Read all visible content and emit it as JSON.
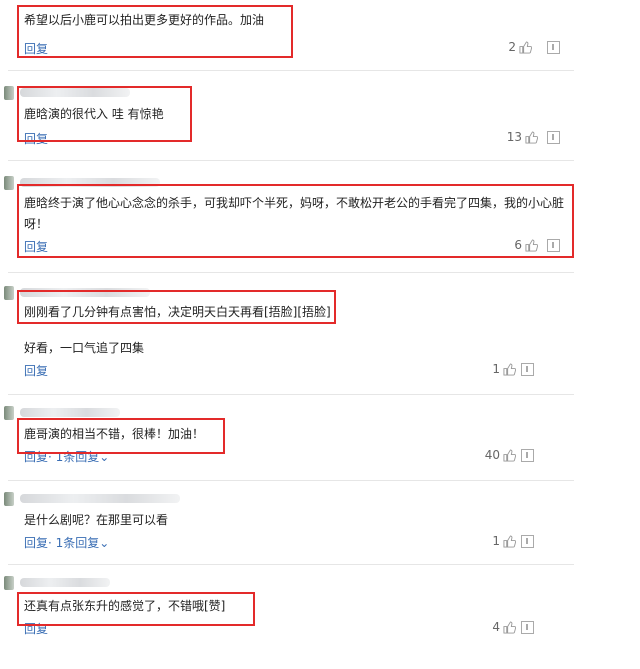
{
  "comments": [
    {
      "text": "希望以后小鹿可以拍出更多更好的作品。加油",
      "reply": "回复",
      "likes": "2"
    },
    {
      "text": "鹿晗演的很代入 哇 有惊艳",
      "reply": "回复",
      "likes": "13"
    },
    {
      "text": "鹿晗终于演了他心心念念的杀手，可我却吓个半死，妈呀，不敢松开老公的手看完了四集，我的小心脏呀！",
      "reply": "回复",
      "likes": "6"
    },
    {
      "text": "刚刚看了几分钟有点害怕，决定明天白天再看[捂脸][捂脸]"
    },
    {
      "text": "好看，一口气追了四集",
      "reply": "回复",
      "likes": "1"
    },
    {
      "text": "鹿哥演的相当不错，很棒！加油！",
      "reply": "回复",
      "more": "· 1条回复⌄",
      "likes": "40"
    },
    {
      "text": "是什么剧呢？在那里可以看",
      "reply": "回复",
      "more": "· 1条回复⌄",
      "likes": "1"
    },
    {
      "text": "还真有点张东升的感觉了，不错哦[赞]",
      "reply": "回复",
      "likes": "4"
    }
  ],
  "icons": {
    "like": "thumbs-up-icon",
    "report": "report-icon"
  },
  "colors": {
    "highlight": "#e32a2a",
    "reply_link": "#3a6eb4"
  }
}
